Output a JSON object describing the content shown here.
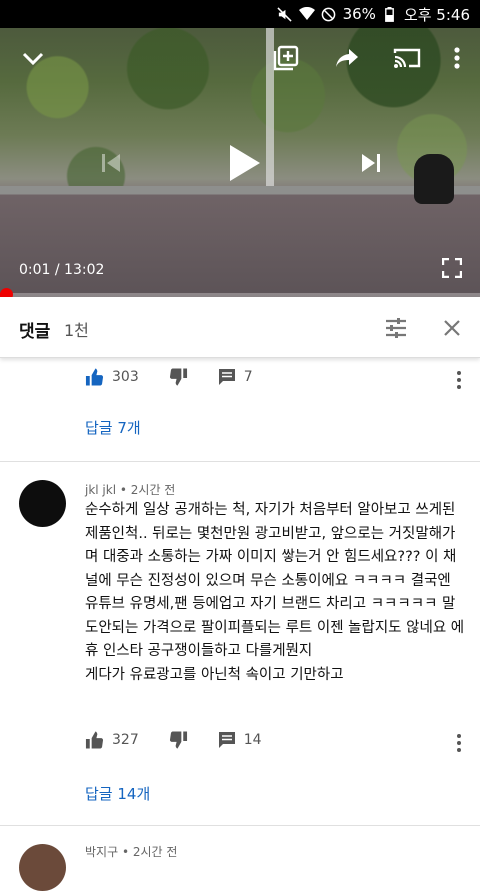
{
  "status_bar": {
    "battery_percent": "36%",
    "time": "오후 5:46",
    "icons": [
      "mute-icon",
      "wifi-icon",
      "do-not-disturb-icon",
      "battery-icon"
    ]
  },
  "player": {
    "current_time": "0:01",
    "duration": "13:02",
    "time_display": "0:01 / 13:02",
    "progress": 0.0013,
    "controls": [
      "collapse-icon",
      "add-to-playlist-icon",
      "share-icon",
      "cast-icon",
      "more-icon",
      "previous-icon",
      "play-icon",
      "next-icon",
      "fullscreen-icon"
    ]
  },
  "comments_header": {
    "title": "댓글",
    "count": "1천"
  },
  "comments": [
    {
      "likes": "303",
      "replies_count": "7",
      "replies_label": "답글 7개"
    },
    {
      "author": "jkl jkl",
      "separator": " • ",
      "time": "2시간 전",
      "text": "순수하게 일상 공개하는 척, 자기가 처음부터 알아보고 쓰게된 제품인척.. 뒤로는 몇천만원 광고비받고, 앞으로는 거짓말해가며 대중과 소통하는 가짜 이미지 쌓는거 안 힘드세요??? 이 채널에 무슨 진정성이 있으며 무슨 소통이에요 ㅋㅋㅋㅋ 결국엔 유튜브 유명세,팬 등에업고 자기 브랜드 차리고 ㅋㅋㅋㅋㅋ 말도안되는 가격으로 팔이피플되는 루트 이젠 놀랍지도 않네요 에휴 인스타 공구쟁이들하고 다를게뭔지\n게다가 유료광고를 아닌척 속이고 기만하고",
      "likes": "327",
      "replies_count": "14",
      "replies_label": "답글 14개"
    },
    {
      "author": "박지구",
      "separator": " • ",
      "time": "2시간 전"
    }
  ],
  "colors": {
    "accent_red": "#ee0000",
    "link_blue": "#1565c0"
  }
}
